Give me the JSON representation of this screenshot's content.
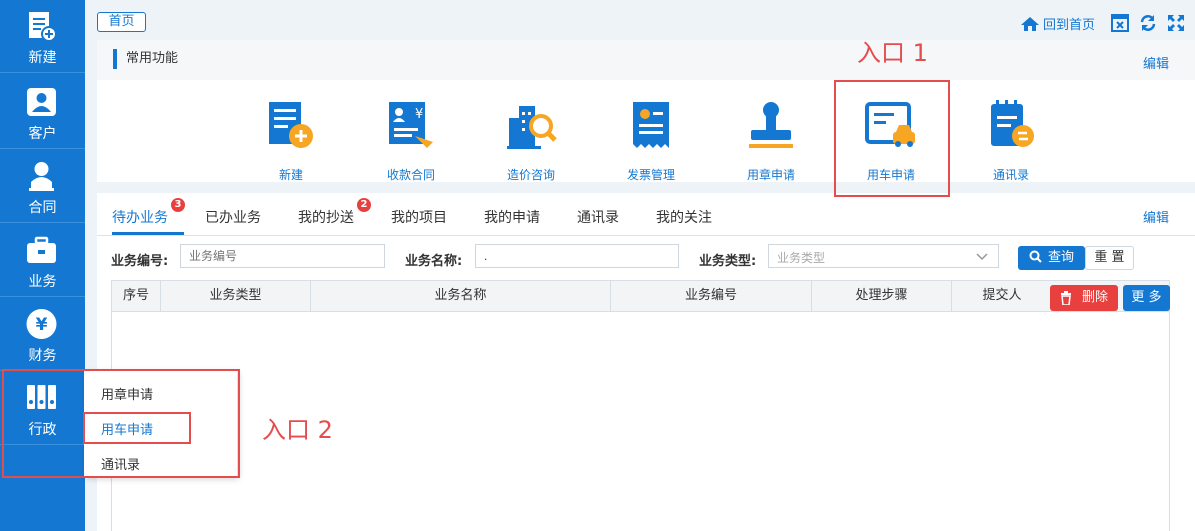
{
  "colors": {
    "primary": "#1478d2",
    "danger": "#e8403f",
    "annotation": "#e44d4d"
  },
  "sidebar": {
    "items": [
      {
        "label": "新建",
        "icon": "new-doc-icon"
      },
      {
        "label": "客户",
        "icon": "person-icon"
      },
      {
        "label": "合同",
        "icon": "stamp-person-icon"
      },
      {
        "label": "业务",
        "icon": "briefcase-icon"
      },
      {
        "label": "财务",
        "icon": "yen-icon"
      },
      {
        "label": "行政",
        "icon": "binders-icon"
      }
    ]
  },
  "topbar": {
    "home_tab": "首页",
    "back_home": "回到首页",
    "icons": [
      "close-window-icon",
      "refresh-icon",
      "fullscreen-icon"
    ]
  },
  "common": {
    "title": "常用功能",
    "edit": "编辑",
    "functions": [
      {
        "label": "新建",
        "icon": "new-doc-plus-icon"
      },
      {
        "label": "收款合同",
        "icon": "contract-yen-icon"
      },
      {
        "label": "造价咨询",
        "icon": "building-search-icon"
      },
      {
        "label": "发票管理",
        "icon": "invoice-gear-icon"
      },
      {
        "label": "用章申请",
        "icon": "stamp-icon"
      },
      {
        "label": "用车申请",
        "icon": "car-form-icon"
      },
      {
        "label": "通讯录",
        "icon": "address-book-icon"
      }
    ]
  },
  "tabs": {
    "items": [
      {
        "label": "待办业务",
        "badge": "3"
      },
      {
        "label": "已办业务"
      },
      {
        "label": "我的抄送",
        "badge": "2"
      },
      {
        "label": "我的项目"
      },
      {
        "label": "我的申请"
      },
      {
        "label": "通讯录"
      },
      {
        "label": "我的关注"
      }
    ],
    "edit": "编辑"
  },
  "filters": {
    "code_label": "业务编号:",
    "code_placeholder": "业务编号",
    "name_label": "业务名称:",
    "name_value": ".",
    "type_label": "业务类型:",
    "type_placeholder": "业务类型",
    "search_btn": "查询",
    "reset_btn": "重 置"
  },
  "table": {
    "columns": [
      "序号",
      "业务类型",
      "业务名称",
      "业务编号",
      "处理步骤",
      "提交人"
    ],
    "delete_btn": "删除",
    "more_btn": "更 多"
  },
  "popup": {
    "items": [
      "用章申请",
      "用车申请",
      "通讯录"
    ]
  },
  "annotations": {
    "entry1": "入口 1",
    "entry2": "入口 2"
  }
}
